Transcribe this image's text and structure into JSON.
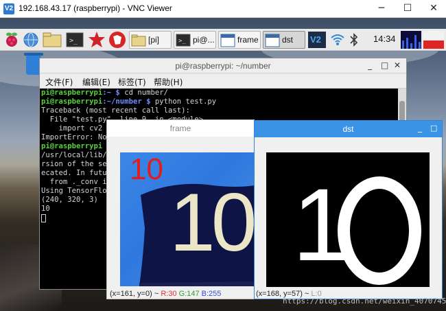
{
  "vnc": {
    "logo": "V2",
    "title": "192.168.43.17 (raspberrypi) - VNC Viewer",
    "minimize_glyph": "─",
    "maximize_glyph": "☐",
    "close_glyph": "✕"
  },
  "taskbar": {
    "folder_pi_label": "[pi]",
    "terminal_label": "pi@...",
    "frame_label": "frame",
    "dst_label": "dst",
    "clock": "14:34"
  },
  "terminal": {
    "title": "pi@raspberrypi: ~/number",
    "menu": [
      "文件(F)",
      "编辑(E)",
      "标签(T)",
      "帮助(H)"
    ],
    "win_controls": [
      "_",
      "□",
      "✕"
    ],
    "lines": {
      "l1_user": "pi@raspberrypi",
      "l1_path": ":~ $ ",
      "l1_cmd": "cd number/",
      "l2_user": "pi@raspberrypi",
      "l2_path": ":~/number $ ",
      "l2_cmd": "python test.py",
      "l3": "Traceback (most recent call last):",
      "l4": "  File \"test.py\", line 9, in <module>",
      "l5": "    import cv2",
      "l6": "ImportError: No",
      "l7_user": "pi@raspberrypi",
      "l8": "/usr/local/lib/",
      "l9": "rsion of the se",
      "l10": "ecated. In futu",
      "l11": "  from ._conv i",
      "l12": "Using TensorFlo",
      "l13": "(240, 320, 3)",
      "l14": "10"
    }
  },
  "frame_window": {
    "title": "frame",
    "overlay_number": "10",
    "card_text": "10",
    "status_prefix": "(x=161, y=0) ~",
    "status_r": "R:30",
    "status_g": "G:147",
    "status_b": "B:255"
  },
  "dst_window": {
    "title": "dst",
    "min_glyph": "_",
    "max_glyph": "□",
    "digit_one": "1",
    "status_prefix": "(x=168, y=57) ~",
    "status_l": "L:0"
  },
  "watermark": "https://blog.csdn.net/weixin_40707450",
  "colors": {
    "prompt_user": "#56d33a",
    "prompt_path": "#6f8cff",
    "dst_titlebar": "#3b93e5",
    "overlay_red": "#e21b1b",
    "status_r": "#e23030",
    "status_g": "#2f9e2f",
    "status_b": "#2f4fd8"
  }
}
